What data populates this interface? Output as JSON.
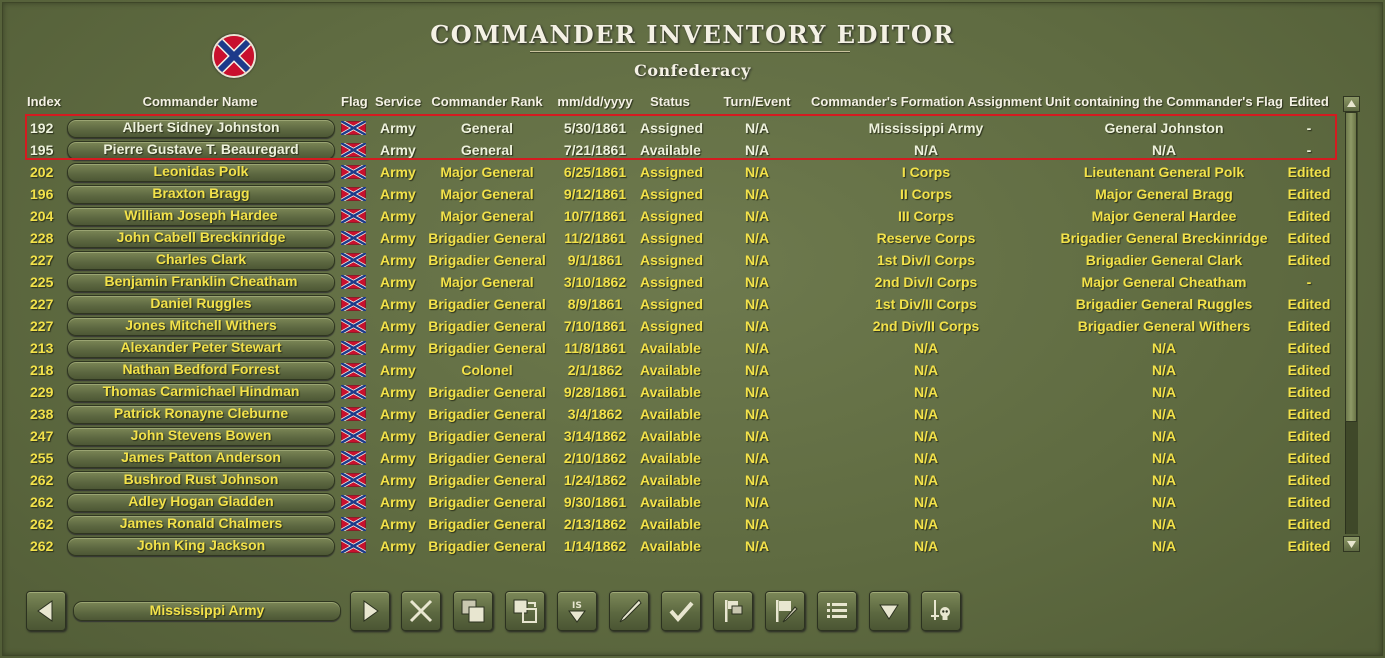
{
  "window": {
    "title": "COMMANDER INVENTORY EDITOR",
    "subtitle": "Confederacy"
  },
  "columns": {
    "index": "Index",
    "name": "Commander Name",
    "flag": "Flag",
    "service": "Service",
    "rank": "Commander Rank",
    "date": "mm/dd/yyyy",
    "status": "Status",
    "turn": "Turn/Event",
    "formation": "Commander's Formation Assignment",
    "unit": "Unit containing the Commander's Flag",
    "edited": "Edited"
  },
  "rows": [
    {
      "index": "192",
      "name": "Albert Sidney Johnston",
      "service": "Army",
      "rank": "General",
      "date": "5/30/1861",
      "status": "Assigned",
      "turn": "N/A",
      "formation": "Mississippi Army",
      "unit": "General Johnston",
      "edited": "-"
    },
    {
      "index": "195",
      "name": "Pierre Gustave T. Beauregard",
      "service": "Army",
      "rank": "General",
      "date": "7/21/1861",
      "status": "Available",
      "turn": "N/A",
      "formation": "N/A",
      "unit": "N/A",
      "edited": "-"
    },
    {
      "index": "202",
      "name": "Leonidas Polk",
      "service": "Army",
      "rank": "Major General",
      "date": "6/25/1861",
      "status": "Assigned",
      "turn": "N/A",
      "formation": "I Corps",
      "unit": "Lieutenant General Polk",
      "edited": "Edited"
    },
    {
      "index": "196",
      "name": "Braxton Bragg",
      "service": "Army",
      "rank": "Major General",
      "date": "9/12/1861",
      "status": "Assigned",
      "turn": "N/A",
      "formation": "II Corps",
      "unit": "Major General Bragg",
      "edited": "Edited"
    },
    {
      "index": "204",
      "name": "William Joseph Hardee",
      "service": "Army",
      "rank": "Major General",
      "date": "10/7/1861",
      "status": "Assigned",
      "turn": "N/A",
      "formation": "III Corps",
      "unit": "Major General Hardee",
      "edited": "Edited"
    },
    {
      "index": "228",
      "name": "John Cabell Breckinridge",
      "service": "Army",
      "rank": "Brigadier General",
      "date": "11/2/1861",
      "status": "Assigned",
      "turn": "N/A",
      "formation": "Reserve Corps",
      "unit": "Brigadier General Breckinridge",
      "edited": "Edited"
    },
    {
      "index": "227",
      "name": "Charles Clark",
      "service": "Army",
      "rank": "Brigadier General",
      "date": "9/1/1861",
      "status": "Assigned",
      "turn": "N/A",
      "formation": "1st Div/I Corps",
      "unit": "Brigadier General Clark",
      "edited": "Edited"
    },
    {
      "index": "225",
      "name": "Benjamin Franklin Cheatham",
      "service": "Army",
      "rank": "Major General",
      "date": "3/10/1862",
      "status": "Assigned",
      "turn": "N/A",
      "formation": "2nd Div/I Corps",
      "unit": "Major General Cheatham",
      "edited": "-"
    },
    {
      "index": "227",
      "name": "Daniel Ruggles",
      "service": "Army",
      "rank": "Brigadier General",
      "date": "8/9/1861",
      "status": "Assigned",
      "turn": "N/A",
      "formation": "1st Div/II Corps",
      "unit": "Brigadier General Ruggles",
      "edited": "Edited"
    },
    {
      "index": "227",
      "name": "Jones Mitchell Withers",
      "service": "Army",
      "rank": "Brigadier General",
      "date": "7/10/1861",
      "status": "Assigned",
      "turn": "N/A",
      "formation": "2nd Div/II Corps",
      "unit": "Brigadier General Withers",
      "edited": "Edited"
    },
    {
      "index": "213",
      "name": "Alexander Peter Stewart",
      "service": "Army",
      "rank": "Brigadier General",
      "date": "11/8/1861",
      "status": "Available",
      "turn": "N/A",
      "formation": "N/A",
      "unit": "N/A",
      "edited": "Edited"
    },
    {
      "index": "218",
      "name": "Nathan Bedford Forrest",
      "service": "Army",
      "rank": "Colonel",
      "date": "2/1/1862",
      "status": "Available",
      "turn": "N/A",
      "formation": "N/A",
      "unit": "N/A",
      "edited": "Edited"
    },
    {
      "index": "229",
      "name": "Thomas Carmichael Hindman",
      "service": "Army",
      "rank": "Brigadier General",
      "date": "9/28/1861",
      "status": "Available",
      "turn": "N/A",
      "formation": "N/A",
      "unit": "N/A",
      "edited": "Edited"
    },
    {
      "index": "238",
      "name": "Patrick Ronayne Cleburne",
      "service": "Army",
      "rank": "Brigadier General",
      "date": "3/4/1862",
      "status": "Available",
      "turn": "N/A",
      "formation": "N/A",
      "unit": "N/A",
      "edited": "Edited"
    },
    {
      "index": "247",
      "name": "John Stevens Bowen",
      "service": "Army",
      "rank": "Brigadier General",
      "date": "3/14/1862",
      "status": "Available",
      "turn": "N/A",
      "formation": "N/A",
      "unit": "N/A",
      "edited": "Edited"
    },
    {
      "index": "255",
      "name": "James Patton Anderson",
      "service": "Army",
      "rank": "Brigadier General",
      "date": "2/10/1862",
      "status": "Available",
      "turn": "N/A",
      "formation": "N/A",
      "unit": "N/A",
      "edited": "Edited"
    },
    {
      "index": "262",
      "name": "Bushrod Rust Johnson",
      "service": "Army",
      "rank": "Brigadier General",
      "date": "1/24/1862",
      "status": "Available",
      "turn": "N/A",
      "formation": "N/A",
      "unit": "N/A",
      "edited": "Edited"
    },
    {
      "index": "262",
      "name": "Adley Hogan Gladden",
      "service": "Army",
      "rank": "Brigadier General",
      "date": "9/30/1861",
      "status": "Available",
      "turn": "N/A",
      "formation": "N/A",
      "unit": "N/A",
      "edited": "Edited"
    },
    {
      "index": "262",
      "name": "James Ronald Chalmers",
      "service": "Army",
      "rank": "Brigadier General",
      "date": "2/13/1862",
      "status": "Available",
      "turn": "N/A",
      "formation": "N/A",
      "unit": "N/A",
      "edited": "Edited"
    },
    {
      "index": "262",
      "name": "John King Jackson",
      "service": "Army",
      "rank": "Brigadier General",
      "date": "1/14/1862",
      "status": "Available",
      "turn": "N/A",
      "formation": "N/A",
      "unit": "N/A",
      "edited": "Edited"
    }
  ],
  "toolbar": {
    "formation_selector": "Mississippi Army",
    "icons": [
      "prev-arrow-icon",
      "next-arrow-icon",
      "delete-x-icon",
      "duplicate-icon",
      "swap-icon",
      "transfer-icon",
      "quill-icon",
      "checkmark-icon",
      "flag-icon",
      "flag-edit-icon",
      "list-icon",
      "dropdown-icon",
      "sword-skull-icon"
    ]
  },
  "colors": {
    "text_yellow": "#f3e24a",
    "text_highlight": "#eef2dc",
    "selection_border": "#d41b20",
    "background": "#5f6b41"
  }
}
